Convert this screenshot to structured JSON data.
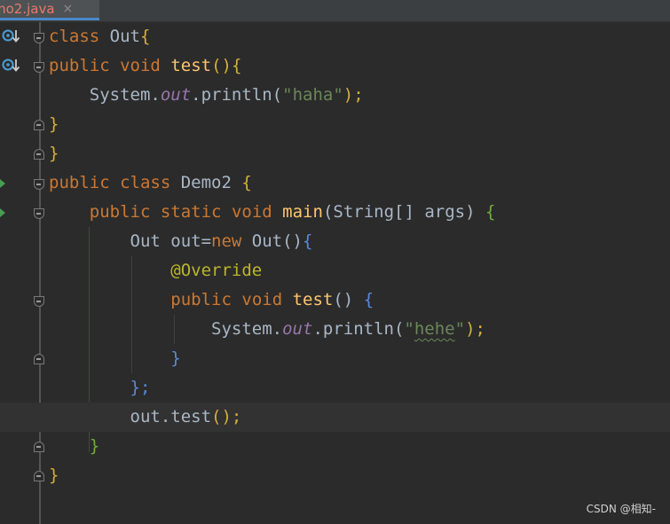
{
  "tab": {
    "label": "mo2.java",
    "close": "×"
  },
  "lines": [
    [
      "class",
      " Out",
      "{"
    ],
    [
      "public",
      " ",
      "void",
      " ",
      "test",
      "(){"
    ],
    [
      "    System.",
      "out",
      ".println(",
      "\"haha\"",
      ");"
    ],
    [
      "}"
    ],
    [
      "}"
    ],
    [
      "public",
      " ",
      "class",
      " Demo2 ",
      "{"
    ],
    [
      "    ",
      "public",
      " ",
      "static",
      " ",
      "void",
      " ",
      "main",
      "(String[] args) ",
      "{"
    ],
    [
      "        Out out=",
      "new",
      " Out()",
      "{"
    ],
    [
      "            ",
      "@Override"
    ],
    [
      "            ",
      "public",
      " ",
      "void",
      " ",
      "test",
      "() ",
      "{"
    ],
    [
      "                System.",
      "out",
      ".println(",
      "\"",
      "hehe",
      "\"",
      ");"
    ],
    [
      "            ",
      "}"
    ],
    [
      "        ",
      "};"
    ],
    [
      "        out.test",
      "();"
    ],
    [
      "    ",
      "}"
    ],
    [
      "}"
    ]
  ],
  "watermark": "CSDN @相知-",
  "icons": {
    "impl": "implemented-method-icon",
    "run": "run-gutter-icon",
    "fold": "fold-marker-icon"
  }
}
